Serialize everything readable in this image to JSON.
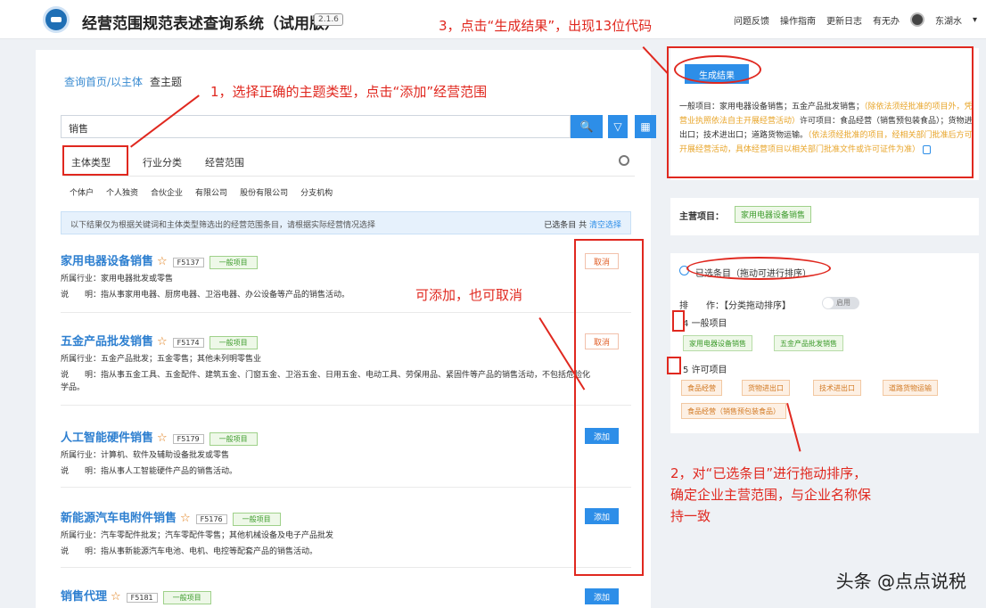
{
  "header": {
    "app_title": "经营范围规范表述查询系统（试用版）",
    "version": "2.1.6",
    "nav_items": [
      "问题反馈",
      "操作指南",
      "更新日志",
      "有无办",
      "东湖水"
    ]
  },
  "left": {
    "breadcrumb": "查询首页/以主体",
    "tab": "查主题",
    "search": {
      "value": "销售",
      "search_label": "🔍",
      "filter_label": "▽",
      "grid_label": "▦"
    },
    "category_tabs": [
      "主体类型",
      "行业分类",
      "经营范围"
    ],
    "subcategories": [
      "个体户",
      "个人独资",
      "合伙企业",
      "有限公司",
      "股份有限公司",
      "分支机构"
    ],
    "notice": "以下结果仅为根据关键词和主体类型筛选出的经营范围条目，请根据实际经营情况选择",
    "notice_right": {
      "label": "已选条目",
      "count": "共",
      "link": "清空选择"
    },
    "items": [
      {
        "title": "家用电器设备销售",
        "code": "F5137",
        "tag": "一般项目",
        "industry": "所属行业：家用电器批发或零售",
        "desc": "说　　明：指从事家用电器、厨房电器、卫浴电器、办公设备等产品的销售活动。",
        "action": "取消"
      },
      {
        "title": "五金产品批发销售",
        "code": "F5174",
        "tag": "一般项目",
        "industry": "所属行业：五金产品批发；五金零售；其他未列明零售业",
        "desc": "说　　明：指从事五金工具、五金配件、建筑五金、门窗五金、卫浴五金、日用五金、电动工具、劳保用品、紧固件等产品的销售活动，不包括危险化学品。",
        "action": "取消"
      },
      {
        "title": "人工智能硬件销售",
        "code": "F5179",
        "tag": "一般项目",
        "industry": "所属行业：计算机、软件及辅助设备批发或零售",
        "desc": "说　　明：指从事人工智能硬件产品的销售活动。",
        "action": "添加"
      },
      {
        "title": "新能源汽车电附件销售",
        "code": "F5176",
        "tag": "一般项目",
        "industry": "所属行业：汽车零配件批发；汽车零配件零售；其他机械设备及电子产品批发",
        "desc": "说　　明：指从事新能源汽车电池、电机、电控等配套产品的销售活动。",
        "action": "添加"
      },
      {
        "title": "销售代理",
        "code": "F5181",
        "tag": "一般项目",
        "action": "添加"
      }
    ]
  },
  "right": {
    "generate_label": "生成结果",
    "result_plain_1": "一般项目：家用电器设备销售；五金产品批发销售；",
    "result_hl_1": "（除依法须经批准的项目外，凭营业执照依法自主开展经营活动）",
    "result_plain_2": "许可项目：食品经营（销售预包装食品）；货物进出口；技术进出口；道路货物运输。",
    "result_hl_2": "（依法须经批准的项目，经相关部门批准后方可开展经营活动，具体经营项目以相关部门批准文件或许可证件为准）",
    "main_business_label": "主营项目：",
    "main_business_value": "家用电器设备销售",
    "selected_title": "已选条目（拖动可进行排序）",
    "sort_label": "排　　作：【分类拖动排序】",
    "toggle_text": "启用",
    "general_count": "4",
    "general_label": "一般项目",
    "general_chips": [
      "家用电器设备销售",
      "五金产品批发销售"
    ],
    "permit_count": "5",
    "permit_label": "许可项目",
    "permit_chips": [
      "食品经营",
      "货物进出口",
      "技术进出口",
      "道路货物运输",
      "食品经营（销售预包装食品）"
    ]
  },
  "annotations": {
    "step1": "1，选择正确的主题类型，点击“添加”经营范围",
    "step3": "3，点击“生成结果”，出现13位代码",
    "middle": "可添加，也可取消",
    "step2_line1": "2，对“已选条目”进行拖动排序，",
    "step2_line2": "确定企业主营范围，与企业名称保",
    "step2_line3": "持一致"
  },
  "watermark": "头条 @点点说税"
}
